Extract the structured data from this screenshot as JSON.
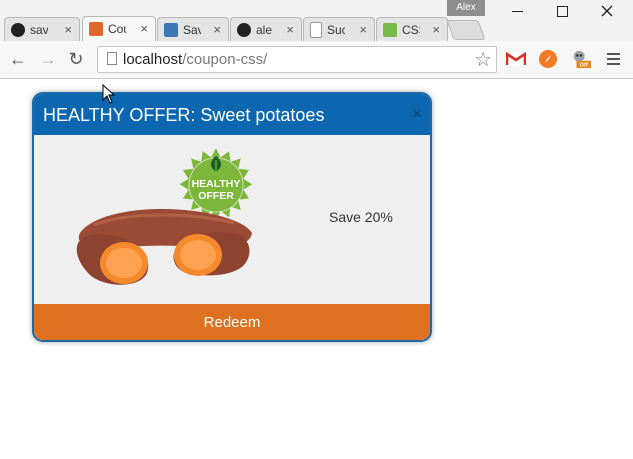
{
  "window": {
    "profile_name": "Alex",
    "minimize_icon": "minimize-icon",
    "maximize_icon": "maximize-icon",
    "close_icon": "close-icon"
  },
  "tabs": [
    {
      "title": "sav",
      "icon": "github-icon",
      "fav_color": "#222222",
      "fav_glyph": "◉",
      "active": false
    },
    {
      "title": "Cou",
      "icon": "xampp-icon",
      "fav_color": "#e0672b",
      "fav_glyph": "⊠",
      "active": true
    },
    {
      "title": "Sav",
      "icon": "blue-square-icon",
      "fav_color": "#3b78b5",
      "fav_glyph": "▦",
      "active": false
    },
    {
      "title": "ale",
      "icon": "github-icon",
      "fav_color": "#222222",
      "fav_glyph": "◉",
      "active": false
    },
    {
      "title": "Suc",
      "icon": "page-icon",
      "fav_color": "#bbbbbb",
      "fav_glyph": "▢",
      "active": false
    },
    {
      "title": "CSS",
      "icon": "css-icon",
      "fav_color": "#79b94a",
      "fav_glyph": "3",
      "active": false
    }
  ],
  "tab_close_glyph": "×",
  "toolbar": {
    "url_host": "localhost",
    "url_path": "/coupon-css/",
    "back_glyph": "←",
    "forward_glyph": "→",
    "reload_glyph": "↻",
    "star_glyph": "☆",
    "extensions": [
      "gmail-icon",
      "compass-icon",
      "robot-extension-icon",
      "menu-icon"
    ],
    "robot_badge": "Off"
  },
  "coupon": {
    "title": "HEALTHY OFFER: Sweet potatoes",
    "close_glyph": "×",
    "badge_line1": "HEALTHY",
    "badge_line2": "OFFER",
    "save_text": "Save 20%",
    "redeem_label": "Redeem",
    "colors": {
      "header": "#0d67b0",
      "border": "#1a6aa9",
      "body": "#efefef",
      "button": "#dd7120",
      "badge": "#7cb63a"
    }
  }
}
